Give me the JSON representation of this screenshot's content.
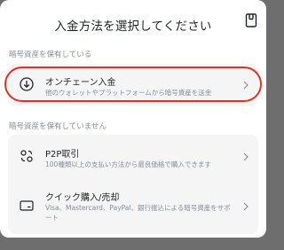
{
  "header": {
    "title": "入金方法を選択してください",
    "right_icon": "document-icon"
  },
  "sections": [
    {
      "label": "暗号資産を保有している",
      "items": [
        {
          "title": "オンチェーン入金",
          "description": "他のウォレットやプラットフォームから暗号資産を送金",
          "icon": "download-circle-icon"
        }
      ]
    },
    {
      "label": "暗号資産を保有していません",
      "items": [
        {
          "title": "P2P取引",
          "description": "100種類以上の支払い方法から最良価格で購入できます",
          "icon": "p2p-exchange-icon"
        },
        {
          "title": "クイック購入/売却",
          "description": "Visa、Mastercard、PayPal、銀行振込による暗号資産をサポート",
          "icon": "card-icon"
        }
      ]
    }
  ],
  "colors": {
    "highlight": "#e8301e",
    "card_bg": "#f5f5f5",
    "text_primary": "#1e2329",
    "text_secondary": "#848e9c"
  }
}
